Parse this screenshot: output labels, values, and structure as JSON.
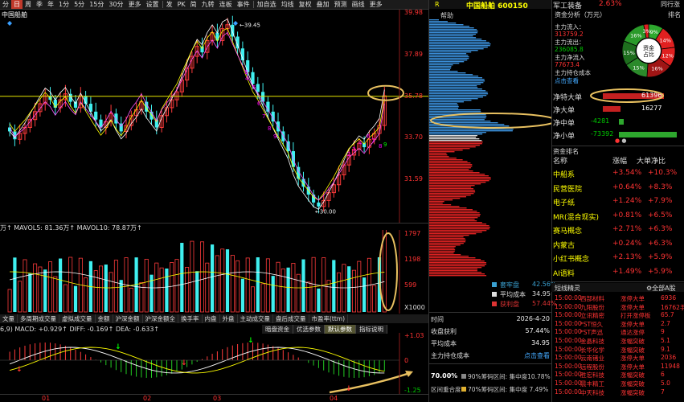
{
  "toolbar": {
    "items": [
      "分",
      "日",
      "周",
      "季",
      "年",
      "1分",
      "5分",
      "15分",
      "30分",
      "更多",
      "设置",
      "发",
      "PK",
      "简",
      "九转",
      "连板",
      "事件",
      "加自选",
      "均线",
      "复权",
      "叠加",
      "预测",
      "画线",
      "更多"
    ],
    "active_index": 1
  },
  "chart": {
    "stock_label": "中国船舶",
    "price_axis": [
      "39.98",
      "37.89",
      "35.78",
      "33.70",
      "31.59"
    ],
    "high_label": "39.45",
    "low_label": "30.00",
    "vol_legend": "万↑ MAVOL5: 81.36万↑ MAVOL10: 78.87万↑",
    "vol_axis": [
      "1797",
      "1198",
      "599",
      "X1000"
    ],
    "macd_legend": "6,9) MACD: +0.929↑ DIFF: -0.169↑ DEA: -0.633↑",
    "macd_axis": [
      "+1.03",
      "0",
      "-1.25"
    ],
    "date_labels": [
      "01",
      "02",
      "03",
      "04"
    ],
    "tabs_bottom": [
      "文量",
      "多周期成交量",
      "虚拟成交量",
      "金额",
      "沪深金额",
      "沪深金额全",
      "换手率",
      "内盘",
      "外盘",
      "主动成交量",
      "盘后成交量",
      "市盈率(ttm)"
    ],
    "tabs_ind": [
      "暗盘资金",
      "优选参数",
      "默认参数",
      "指标说明"
    ],
    "tabs_ind_active": 2
  },
  "chip": {
    "header": "R",
    "title": "中国船舶 600150",
    "help": "帮助",
    "legend": [
      {
        "label": "套牢盘",
        "value": "42.56%",
        "color": "#3aa0d0"
      },
      {
        "label": "平均成本",
        "value": "34.95",
        "color": "#ddd"
      },
      {
        "label": "获利盘",
        "value": "57.44%",
        "color": "#d33"
      }
    ],
    "rows": [
      {
        "label": "时间",
        "value": "2026-4-20",
        "cls": "white"
      },
      {
        "label": "收盘获利",
        "value": "57.44%",
        "cls": "white"
      },
      {
        "label": "平均成本",
        "value": "34.95",
        "cls": "white"
      },
      {
        "label": "主力持仓成本",
        "value": "点击查看",
        "cls": "link"
      }
    ],
    "conc_pct": "70.00%",
    "conc90": "90%筹码区间: 集中度10.78%",
    "conc70": "70%筹码区间: 集中度 7.49%",
    "overlap": "区间重合度"
  },
  "fund": {
    "top_label": "军工装备",
    "top_pct": "2.63%",
    "top_right": "同行涨",
    "title": "资金分析（万元）",
    "ranking": "排名",
    "inflow_label": "主力流入：",
    "inflow": "313759.2",
    "outflow_label": "主力流出：",
    "outflow": "236085.8",
    "net_label": "主力净流入",
    "net": "77673.4",
    "cost_label": "主力持仓成本",
    "cost_link": "点击查看",
    "donut_center": [
      "资金",
      "占比"
    ],
    "donut": [
      {
        "v": 9,
        "c": "#2ea82e",
        "l": "9%"
      },
      {
        "v": 14,
        "c": "#e02020",
        "l": "14%"
      },
      {
        "v": 12,
        "c": "#e02020",
        "l": "12%"
      },
      {
        "v": 16,
        "c": "#a01515",
        "l": "16%"
      },
      {
        "v": 15,
        "c": "#2b8a2b",
        "l": "15%"
      },
      {
        "v": 15,
        "c": "#1e6e1e",
        "l": "15%"
      },
      {
        "v": 16,
        "c": "#2a9a2a",
        "l": "16%"
      },
      {
        "v": 3,
        "c": "#e02020",
        "l": "3%"
      }
    ],
    "flows": [
      {
        "label": "净特大单",
        "value": "61396",
        "dir": "up",
        "mag": 0.95
      },
      {
        "label": "净大单",
        "value": "16277",
        "dir": "up",
        "mag": 0.28
      },
      {
        "label": "净中单",
        "value": "-4281",
        "dir": "down",
        "mag": 0.07
      },
      {
        "label": "净小单",
        "value": "-73392",
        "dir": "down",
        "mag": 0.9
      }
    ]
  },
  "sectors": {
    "header_name": "资金排名",
    "header_change": "涨幅",
    "header_net": "大单净比",
    "rows": [
      {
        "name": "中船系",
        "change": "+3.54%",
        "net": "+10.3%"
      },
      {
        "name": "民营医院",
        "change": "+0.64%",
        "net": "+8.3%"
      },
      {
        "name": "电子纸",
        "change": "+1.24%",
        "net": "+7.9%"
      },
      {
        "name": "MR(混合现实)",
        "change": "+0.81%",
        "net": "+6.5%"
      },
      {
        "name": "赛马概念",
        "change": "+2.71%",
        "net": "+6.3%"
      },
      {
        "name": "内蒙古",
        "change": "+0.24%",
        "net": "+6.3%"
      },
      {
        "name": "小红书概念",
        "change": "+2.13%",
        "net": "+5.9%"
      },
      {
        "name": "AI语料",
        "change": "+1.49%",
        "net": "+5.9%"
      }
    ]
  },
  "alerts": {
    "title": "短线精灵",
    "filter": "全部A股",
    "rows": [
      {
        "t": "15:00:00",
        "n": "西部材料",
        "s": "涨停大单",
        "v": "6936"
      },
      {
        "t": "15:00:00",
        "n": "九阳股份",
        "s": "涨停大单",
        "v": "16762手"
      },
      {
        "t": "15:00:00",
        "n": "立讯精密",
        "s": "打开涨停板",
        "v": "65.7"
      },
      {
        "t": "15:00:00",
        "n": "*ST恒久",
        "s": "涨停大单",
        "v": "2.7"
      },
      {
        "t": "15:00:00",
        "n": "*ST声迅",
        "s": "通达涨停",
        "v": "9"
      },
      {
        "t": "15:00:00",
        "n": "金晶科技",
        "s": "涨幅突破",
        "v": "5.1"
      },
      {
        "t": "15:00:00",
        "n": "长华化学",
        "s": "涨幅突破",
        "v": "9.1"
      },
      {
        "t": "15:00:00",
        "n": "云南锗业",
        "s": "涨停大单",
        "v": "2036"
      },
      {
        "t": "15:00:00",
        "n": "远程股份",
        "s": "涨停大单",
        "v": "11948"
      },
      {
        "t": "15:00:00",
        "n": "胜宏科技",
        "s": "涨幅突破",
        "v": "6"
      },
      {
        "t": "15:00:00",
        "n": "晨丰精工",
        "s": "涨幅突破",
        "v": "5.0"
      },
      {
        "t": "15:00:00",
        "n": "中天科技",
        "s": "涨幅突破",
        "v": "7"
      }
    ]
  }
}
